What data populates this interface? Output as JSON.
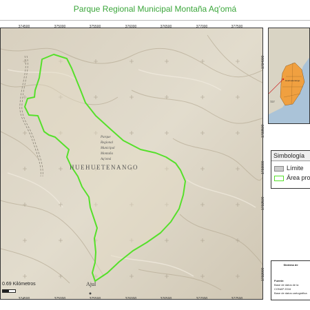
{
  "title": "Parque Regional Municipal Montaña Aq'omá",
  "map": {
    "top_ticks": [
      "374500",
      "375000",
      "375500",
      "376000",
      "376500",
      "377000",
      "377500"
    ],
    "bottom_ticks": [
      "374500",
      "375000",
      "375500",
      "376000",
      "376500",
      "377000",
      "377500"
    ],
    "right_ticks": [
      "1734000",
      "1733500",
      "1733000",
      "1732500",
      "1732000"
    ],
    "region_label": "HUEHUETENANGO",
    "park_label": [
      "Parque",
      "Regional",
      "Municipal",
      "Montaña",
      "Aq'omá"
    ],
    "town_label": "Ajul",
    "scale_label": "0.69 Kilómetros",
    "boundary_color": "#55e02a"
  },
  "inset": {
    "labels": [
      "Huehuetenango",
      "727"
    ],
    "region_color": "#f0a040"
  },
  "legend": {
    "title": "Simbología",
    "items": [
      {
        "label": "Límite",
        "swatch": "#cccccc"
      },
      {
        "label": "Área protegida",
        "swatch": "#ffffff"
      }
    ]
  },
  "info": {
    "title": "Sistema de",
    "lines": [
      "Fuente:",
      "Base de datos de la",
      "CONAP 2016",
      "Base de datos cartográfica"
    ]
  }
}
